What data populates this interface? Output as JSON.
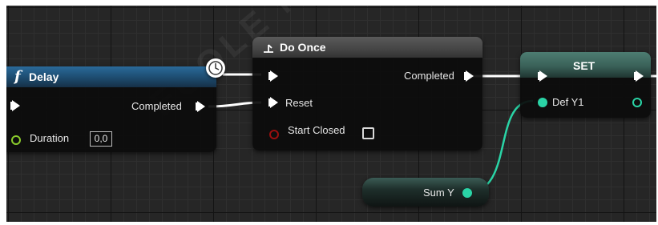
{
  "colors": {
    "float_pin": "#2ad4a6",
    "duration_pin": "#8acb2c",
    "bool_pin": "#9a0f0f",
    "delay_header": "#1d4b6e",
    "do_once_header": "#4b4b4b",
    "set_header": "#3a6158"
  },
  "delay_node": {
    "icon": "function-icon",
    "icon_glyph": "f",
    "title": "Delay",
    "completed_label": "Completed",
    "duration_label": "Duration",
    "duration_value": "0,0"
  },
  "reroute_node": {
    "icon": "clock-icon"
  },
  "do_once_node": {
    "icon": "flow-control-icon",
    "title": "Do Once",
    "completed_label": "Completed",
    "reset_label": "Reset",
    "start_closed_label": "Start Closed",
    "start_closed_checked": false
  },
  "set_node": {
    "title": "SET",
    "var_label": "Def Y1"
  },
  "get_node": {
    "label": "Sum Y"
  },
  "watermark": "ECOLE NATIONALE"
}
